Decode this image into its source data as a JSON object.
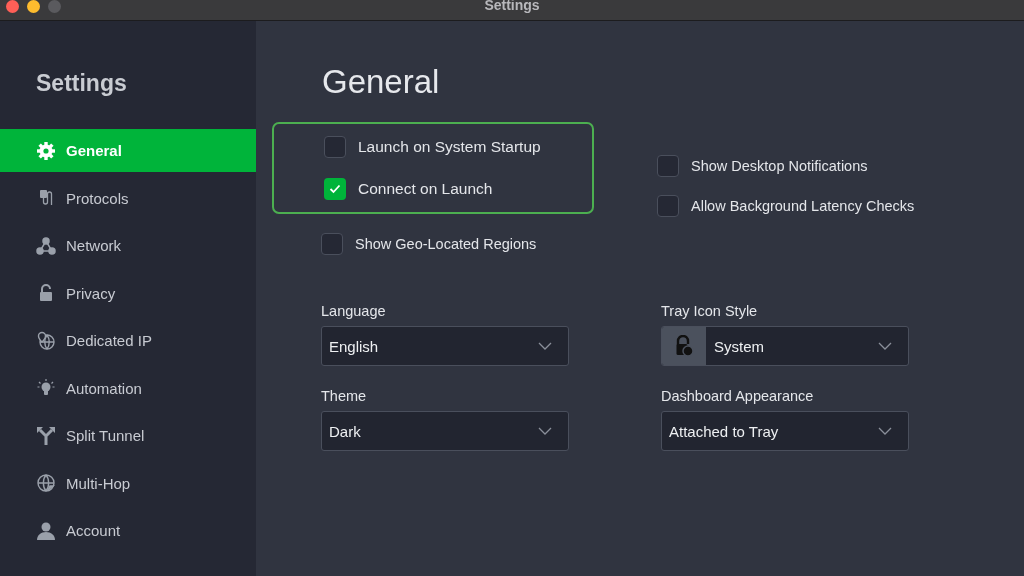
{
  "window": {
    "title": "Settings"
  },
  "sidebar": {
    "title": "Settings",
    "items": [
      {
        "label": "General",
        "selected": true
      },
      {
        "label": "Protocols",
        "selected": false
      },
      {
        "label": "Network",
        "selected": false
      },
      {
        "label": "Privacy",
        "selected": false
      },
      {
        "label": "Dedicated IP",
        "selected": false
      },
      {
        "label": "Automation",
        "selected": false
      },
      {
        "label": "Split Tunnel",
        "selected": false
      },
      {
        "label": "Multi-Hop",
        "selected": false
      },
      {
        "label": "Account",
        "selected": false
      }
    ]
  },
  "page_title": "General",
  "highlighted_options": [
    {
      "label": "Launch on System Startup",
      "checked": false
    },
    {
      "label": "Connect on Launch",
      "checked": true
    }
  ],
  "options_below": [
    {
      "label": "Show Geo-Located Regions",
      "checked": false
    }
  ],
  "right_options": [
    {
      "label": "Show Desktop Notifications",
      "checked": false
    },
    {
      "label": "Allow Background Latency Checks",
      "checked": false
    }
  ],
  "selects": [
    {
      "label": "Language",
      "value": "English"
    },
    {
      "label": "Tray Icon Style",
      "value": "System",
      "kind": "icon"
    },
    {
      "label": "Theme",
      "value": "Dark"
    },
    {
      "label": "Dashboard Appearance",
      "value": "Attached to Tray"
    }
  ]
}
